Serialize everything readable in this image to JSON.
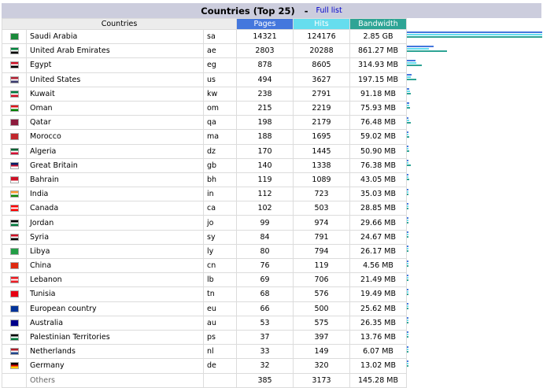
{
  "header": {
    "title": "Countries (Top 25)",
    "separator": "-",
    "full_list": "Full list"
  },
  "columns": {
    "countries": "Countries",
    "pages": "Pages",
    "hits": "Hits",
    "bandwidth": "Bandwidth"
  },
  "colors": {
    "pages": "#4477dd",
    "hits": "#66ddee",
    "bandwidth": "#2ea495",
    "title_bg": "#cccddd"
  },
  "rows": [
    {
      "name": "Saudi Arabia",
      "code": "sa",
      "pages": 14321,
      "hits": 124176,
      "bandwidth": "2.85 GB",
      "bw_mb": 2918.4,
      "flag": [
        "#1a8a3a",
        "#1a8a3a",
        "#1a8a3a"
      ]
    },
    {
      "name": "United Arab Emirates",
      "code": "ae",
      "pages": 2803,
      "hits": 20288,
      "bandwidth": "861.27 MB",
      "bw_mb": 861.27,
      "flag": [
        "#00843d",
        "#ffffff",
        "#000000"
      ]
    },
    {
      "name": "Egypt",
      "code": "eg",
      "pages": 878,
      "hits": 8605,
      "bandwidth": "314.93 MB",
      "bw_mb": 314.93,
      "flag": [
        "#ce1126",
        "#ffffff",
        "#000000"
      ]
    },
    {
      "name": "United States",
      "code": "us",
      "pages": 494,
      "hits": 3627,
      "bandwidth": "197.15 MB",
      "bw_mb": 197.15,
      "flag": [
        "#b22234",
        "#ffffff",
        "#3c3b6e"
      ]
    },
    {
      "name": "Kuwait",
      "code": "kw",
      "pages": 238,
      "hits": 2791,
      "bandwidth": "91.18 MB",
      "bw_mb": 91.18,
      "flag": [
        "#007a3d",
        "#ffffff",
        "#ce1126"
      ]
    },
    {
      "name": "Oman",
      "code": "om",
      "pages": 215,
      "hits": 2219,
      "bandwidth": "75.93 MB",
      "bw_mb": 75.93,
      "flag": [
        "#db161b",
        "#ffffff",
        "#008000"
      ]
    },
    {
      "name": "Qatar",
      "code": "qa",
      "pages": 198,
      "hits": 2179,
      "bandwidth": "76.48 MB",
      "bw_mb": 76.48,
      "flag": [
        "#8d1b3d",
        "#8d1b3d",
        "#8d1b3d"
      ]
    },
    {
      "name": "Morocco",
      "code": "ma",
      "pages": 188,
      "hits": 1695,
      "bandwidth": "59.02 MB",
      "bw_mb": 59.02,
      "flag": [
        "#c1272d",
        "#c1272d",
        "#c1272d"
      ]
    },
    {
      "name": "Algeria",
      "code": "dz",
      "pages": 170,
      "hits": 1445,
      "bandwidth": "50.90 MB",
      "bw_mb": 50.9,
      "flag": [
        "#006233",
        "#ffffff",
        "#d21034"
      ]
    },
    {
      "name": "Great Britain",
      "code": "gb",
      "pages": 140,
      "hits": 1338,
      "bandwidth": "76.38 MB",
      "bw_mb": 76.38,
      "flag": [
        "#012169",
        "#c8102e",
        "#ffffff"
      ]
    },
    {
      "name": "Bahrain",
      "code": "bh",
      "pages": 119,
      "hits": 1089,
      "bandwidth": "43.05 MB",
      "bw_mb": 43.05,
      "flag": [
        "#ce1126",
        "#ce1126",
        "#ffffff"
      ]
    },
    {
      "name": "India",
      "code": "in",
      "pages": 112,
      "hits": 723,
      "bandwidth": "35.03 MB",
      "bw_mb": 35.03,
      "flag": [
        "#ff9933",
        "#ffffff",
        "#138808"
      ]
    },
    {
      "name": "Canada",
      "code": "ca",
      "pages": 102,
      "hits": 503,
      "bandwidth": "28.85 MB",
      "bw_mb": 28.85,
      "flag": [
        "#ff0000",
        "#ffffff",
        "#ff0000"
      ]
    },
    {
      "name": "Jordan",
      "code": "jo",
      "pages": 99,
      "hits": 974,
      "bandwidth": "29.66 MB",
      "bw_mb": 29.66,
      "flag": [
        "#000000",
        "#ffffff",
        "#007a3d"
      ]
    },
    {
      "name": "Syria",
      "code": "sy",
      "pages": 84,
      "hits": 791,
      "bandwidth": "24.67 MB",
      "bw_mb": 24.67,
      "flag": [
        "#ce1126",
        "#ffffff",
        "#000000"
      ]
    },
    {
      "name": "Libya",
      "code": "ly",
      "pages": 80,
      "hits": 794,
      "bandwidth": "26.17 MB",
      "bw_mb": 26.17,
      "flag": [
        "#239e46",
        "#239e46",
        "#239e46"
      ]
    },
    {
      "name": "China",
      "code": "cn",
      "pages": 76,
      "hits": 119,
      "bandwidth": "4.56 MB",
      "bw_mb": 4.56,
      "flag": [
        "#de2910",
        "#de2910",
        "#de2910"
      ]
    },
    {
      "name": "Lebanon",
      "code": "lb",
      "pages": 69,
      "hits": 706,
      "bandwidth": "21.49 MB",
      "bw_mb": 21.49,
      "flag": [
        "#ed1c24",
        "#ffffff",
        "#ed1c24"
      ]
    },
    {
      "name": "Tunisia",
      "code": "tn",
      "pages": 68,
      "hits": 576,
      "bandwidth": "19.49 MB",
      "bw_mb": 19.49,
      "flag": [
        "#e70013",
        "#e70013",
        "#e70013"
      ]
    },
    {
      "name": "European country",
      "code": "eu",
      "pages": 66,
      "hits": 500,
      "bandwidth": "25.62 MB",
      "bw_mb": 25.62,
      "flag": [
        "#003399",
        "#003399",
        "#003399"
      ]
    },
    {
      "name": "Australia",
      "code": "au",
      "pages": 53,
      "hits": 575,
      "bandwidth": "26.35 MB",
      "bw_mb": 26.35,
      "flag": [
        "#00008b",
        "#00008b",
        "#00008b"
      ]
    },
    {
      "name": "Palestinian Territories",
      "code": "ps",
      "pages": 37,
      "hits": 397,
      "bandwidth": "13.76 MB",
      "bw_mb": 13.76,
      "flag": [
        "#000000",
        "#ffffff",
        "#007a3d"
      ]
    },
    {
      "name": "Netherlands",
      "code": "nl",
      "pages": 33,
      "hits": 149,
      "bandwidth": "6.07 MB",
      "bw_mb": 6.07,
      "flag": [
        "#ae1c28",
        "#ffffff",
        "#21468b"
      ]
    },
    {
      "name": "Germany",
      "code": "de",
      "pages": 32,
      "hits": 320,
      "bandwidth": "13.02 MB",
      "bw_mb": 13.02,
      "flag": [
        "#000000",
        "#dd0000",
        "#ffce00"
      ]
    }
  ],
  "others": {
    "name": "Others",
    "pages": 385,
    "hits": 3173,
    "bandwidth": "145.28 MB"
  }
}
